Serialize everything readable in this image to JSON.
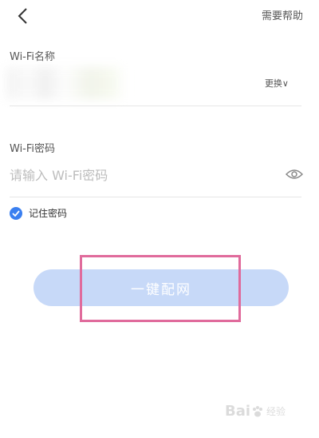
{
  "header": {
    "back_icon": "chevron-left-icon",
    "help_label": "需要帮助"
  },
  "wifi_name": {
    "label": "Wi-Fi名称",
    "value": "",
    "switch_label": "更换∨"
  },
  "wifi_password": {
    "label": "Wi-Fi密码",
    "value": "",
    "placeholder": "请输入 Wi-Fi密码",
    "visibility_icon": "eye-icon"
  },
  "remember_password": {
    "checked": true,
    "label": "记住密码"
  },
  "connect_button": {
    "label": "一键配网"
  },
  "watermark": {
    "text": "Bai",
    "sub": "经验"
  },
  "colors": {
    "accent": "#3a7ff0",
    "button_disabled": "#c7d9f8",
    "highlight": "#e06b9c",
    "divider": "#e6e6e6"
  }
}
